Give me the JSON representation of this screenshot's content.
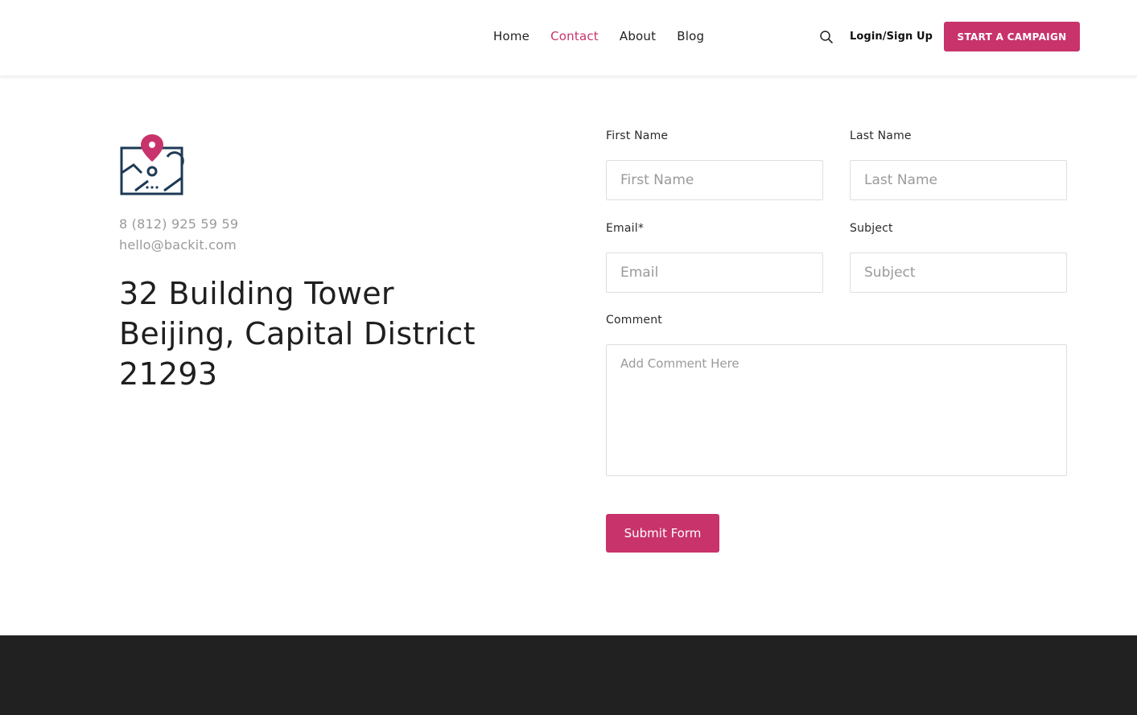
{
  "nav": {
    "items": [
      {
        "label": "Home",
        "active": false
      },
      {
        "label": "Contact",
        "active": true
      },
      {
        "label": "About",
        "active": false
      },
      {
        "label": "Blog",
        "active": false
      }
    ],
    "search_icon": "search-icon",
    "login_label": "Login/Sign Up",
    "cta_label": "START A CAMPAIGN"
  },
  "contact": {
    "icon": "map-pin-icon",
    "phone": "8 (812) 925 59 59",
    "email": "hello@backit.com",
    "address_lines": [
      "32 Building Tower",
      "Beijing, Capital District",
      "21293"
    ]
  },
  "form": {
    "first_name": {
      "label": "First Name",
      "placeholder": "First Name",
      "value": ""
    },
    "last_name": {
      "label": "Last Name",
      "placeholder": "Last Name",
      "value": ""
    },
    "email": {
      "label": "Email*",
      "placeholder": "Email",
      "value": ""
    },
    "subject": {
      "label": "Subject",
      "placeholder": "Subject",
      "value": ""
    },
    "comment": {
      "label": "Comment",
      "placeholder": "Add Comment Here",
      "value": ""
    },
    "submit_label": "Submit Form"
  },
  "colors": {
    "accent": "#c8336b",
    "icon_navy": "#1d3a55",
    "footer_bg": "#212121",
    "muted_text": "#9a9a9a"
  }
}
